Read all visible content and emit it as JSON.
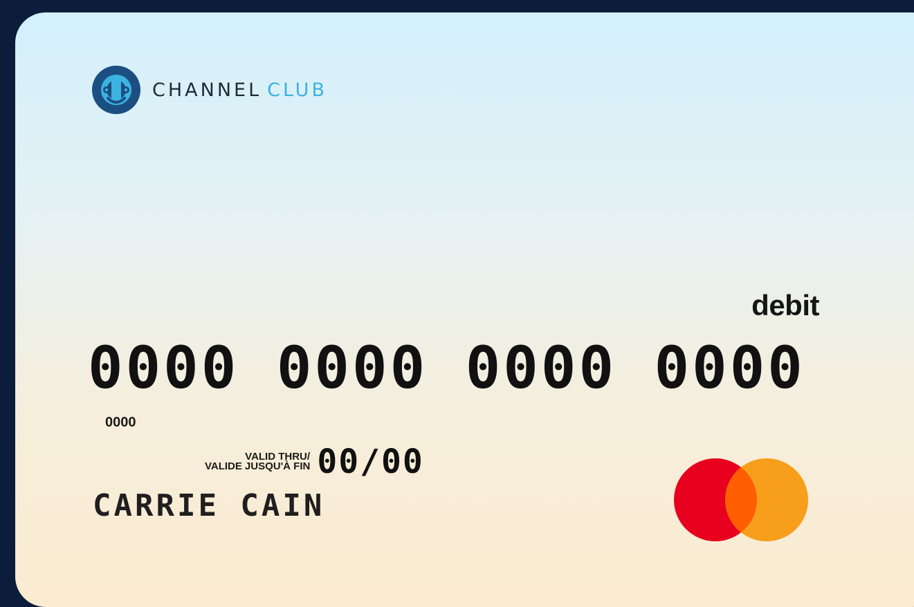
{
  "brand": {
    "name_part1": "CHANNEL",
    "name_part2": "CLUB",
    "icon": "channel-club-logo-icon",
    "primary_color": "#1b4f82",
    "accent_color": "#3cb2e0"
  },
  "card": {
    "type_label": "debit",
    "number": "0000 0000 0000 0000",
    "secondary_number": "0000",
    "valid_label_left": "VALIDE",
    "valid_label_top": "VALID THRU/",
    "valid_label_bottom": "JUSQU'À FIN",
    "expiry": "00/00",
    "holder_name": "CARRIE CAIN",
    "network_icon": "mastercard-logo-icon",
    "network_colors": {
      "red": "#e8001f",
      "orange": "#f79e1b",
      "overlap": "#ff5f00"
    }
  }
}
